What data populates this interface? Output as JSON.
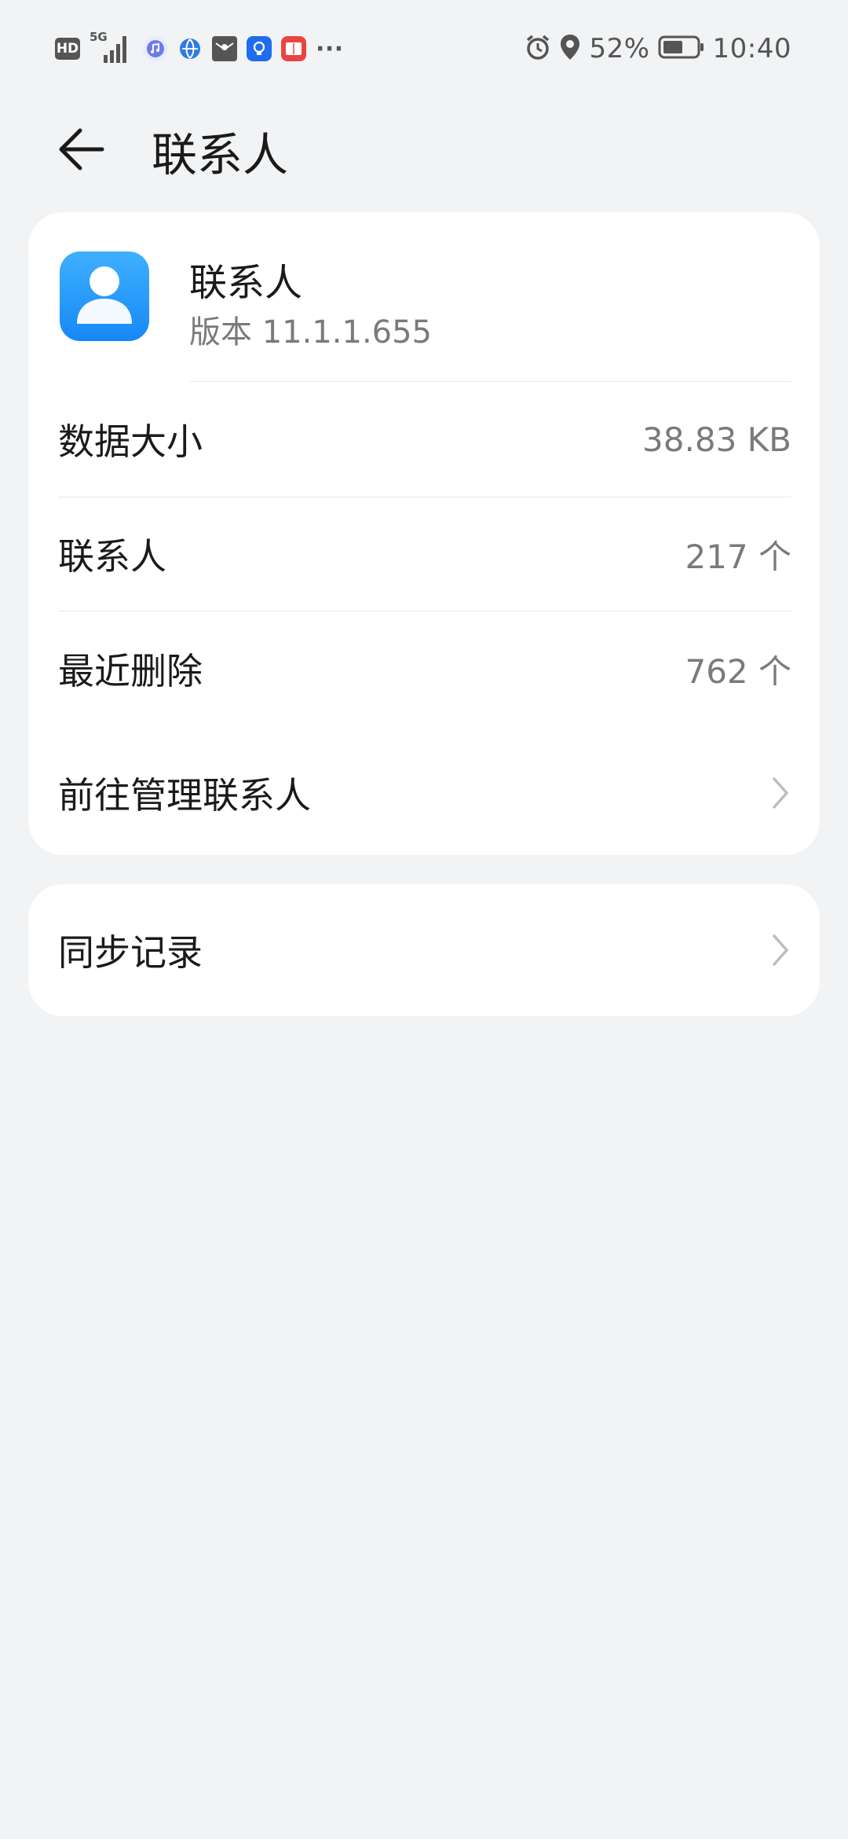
{
  "status_bar": {
    "hd": "HD",
    "network": "5G",
    "battery_percent": "52%",
    "time": "10:40",
    "more": "···",
    "icons": [
      "hd-icon",
      "signal-5g-icon",
      "music-app-icon",
      "browser-app-icon",
      "mail-app-icon",
      "idea-app-icon",
      "reader-app-icon",
      "alarm-icon",
      "location-icon",
      "battery-icon"
    ]
  },
  "header": {
    "title": "联系人",
    "back_icon": "arrow-left-icon"
  },
  "app_info": {
    "name": "联系人",
    "version": "版本 11.1.1.655",
    "icon": "contact-person-icon"
  },
  "rows": [
    {
      "label": "数据大小",
      "value": "38.83 KB"
    },
    {
      "label": "联系人",
      "value": "217 个"
    },
    {
      "label": "最近删除",
      "value": "762 个"
    },
    {
      "label": "前往管理联系人",
      "icon": "chevron-right-icon"
    }
  ],
  "sync": {
    "label": "同步记录",
    "icon": "chevron-right-icon"
  },
  "colors": {
    "background": "#f1f3f5",
    "card": "#ffffff",
    "accent": "#1688f5",
    "secondary_text": "#7a7a7a"
  }
}
